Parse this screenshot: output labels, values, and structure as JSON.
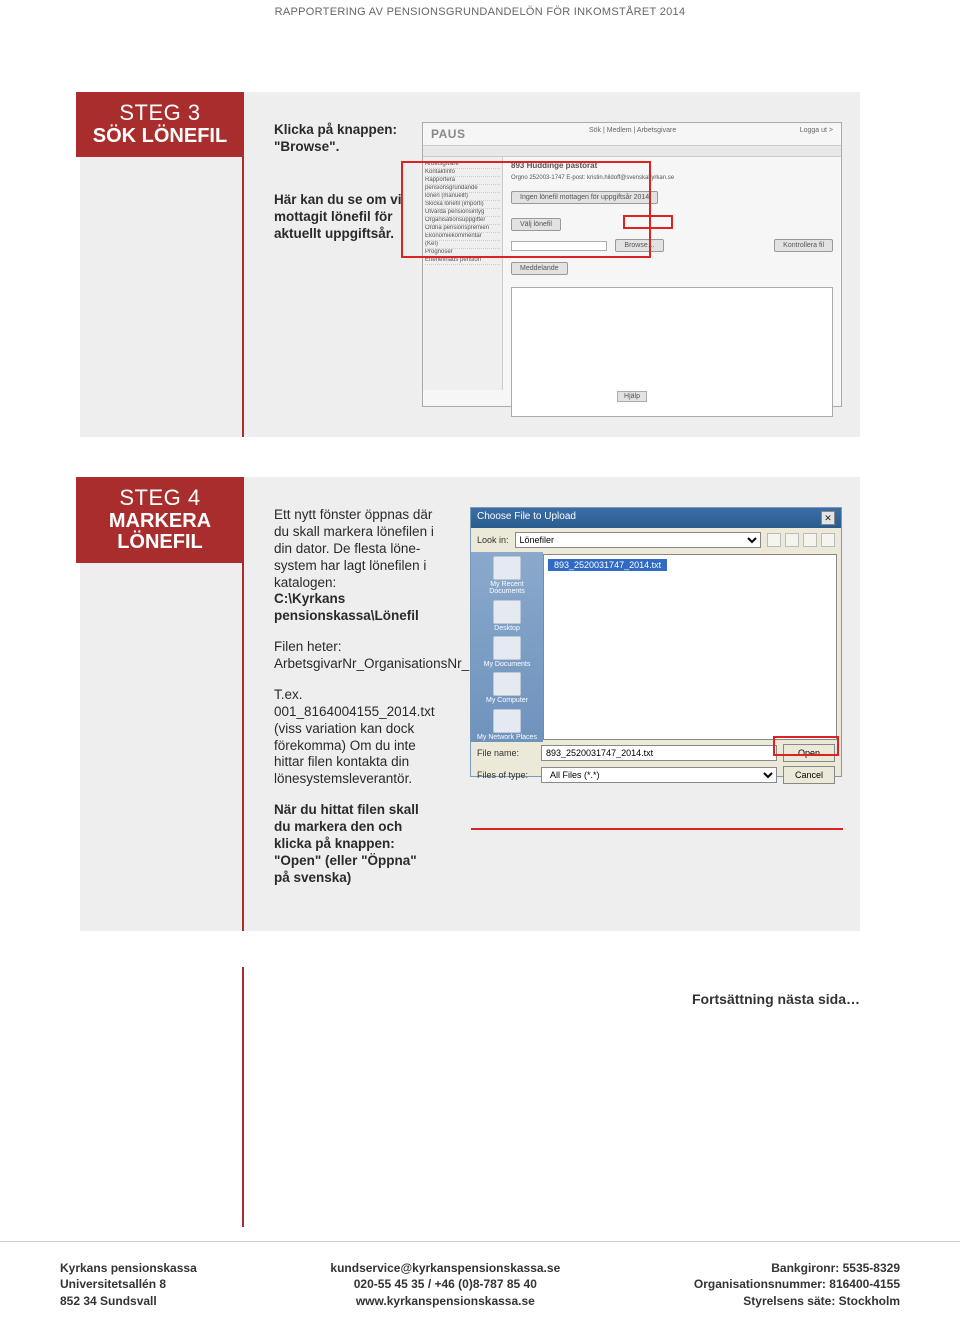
{
  "header": "RAPPORTERING AV PENSIONSGRUNDANDELÖN FÖR INKOMSTÅRET 2014",
  "step3": {
    "num": "STEG 3",
    "title": "SÖK LÖNEFIL",
    "p1": "Klicka på knappen: \"Browse\".",
    "p2": "Här kan du se om vi mottagit lönefil för aktuellt uppgiftsår.",
    "paus": {
      "brand": "PAUS",
      "crumb": "Sök | Medlem | Arbetsgivare",
      "logout": "Logga ut >",
      "sidebar": [
        "Arbetsgivare",
        "Kontaktinfo",
        "Rapportera",
        "pensionsgrundande",
        "lönen (manuellt)",
        "Skicka lönefil (importi)",
        "Utvärda pensionsintyg",
        "Organisationsuppgifter",
        "Ordna pensionspremien",
        "Ekonomiekommentar",
        "(KeI)",
        "Prognoser",
        "Efterlevnads pension"
      ],
      "contentTitle": "893 Huddinge pastorat",
      "infoRow": "Orgno 252003-1747  E-post: kristin.hildoff@svenskakyrkan.se",
      "status": "Ingen lönefil mottagen för uppgiftsår 2014",
      "btnChoose": "Välj lönefil",
      "btnBrowse": "Browse…",
      "btnControl": "Kontrollera fil",
      "sectionMsg": "Meddelande",
      "btnHint": "Hjälp"
    }
  },
  "step4": {
    "num": "STEG 4",
    "title": "MARKERA LÖNEFIL",
    "p1": "Ett nytt fönster öppnas där du skall markera lönefilen i din dator. De flesta löne­system har lagt lönefilen i katalogen:",
    "p1b": "C:\\Kyrkans pensionskassa\\Lönefil",
    "p2": "Filen heter: ArbetsgivarNr_OrganisationsNr_Löneår",
    "p3": "T.ex. 001_8164004155_2014.txt (viss variation kan dock förekomma) Om du inte hittar filen kontakta din lönesystemsleverantör.",
    "p4": "När du hittat filen skall du markera den och klicka på knappen: \"Open\" (eller \"Öppna\" på svenska)",
    "dialog": {
      "title": "Choose File to Upload",
      "lookinLabel": "Look in:",
      "lookinValue": "Lönefiler",
      "places": [
        "My Recent Documents",
        "Desktop",
        "My Documents",
        "My Computer",
        "My Network Places"
      ],
      "file": "893_2520031747_2014.txt",
      "filenameLabel": "File name:",
      "filenameValue": "893_2520031747_2014.txt",
      "filetypeLabel": "Files of type:",
      "filetypeValue": "All Files (*.*)",
      "open": "Open",
      "cancel": "Cancel"
    }
  },
  "continue": "Fortsättning nästa sida…",
  "footer": {
    "l1": "Kyrkans pensionskassa",
    "l2": "Universitetsallén 8",
    "l3": "852 34 Sundsvall",
    "m1": "kundservice@kyrkanspensionskassa.se",
    "m2": "020-55 45 35 / +46 (0)8-787 85 40",
    "m3": "www.kyrkanspensionskassa.se",
    "r1": "Bankgironr: 5535-8329",
    "r2": "Organisationsnummer: 816400-4155",
    "r3": "Styrelsens säte: Stockholm"
  }
}
